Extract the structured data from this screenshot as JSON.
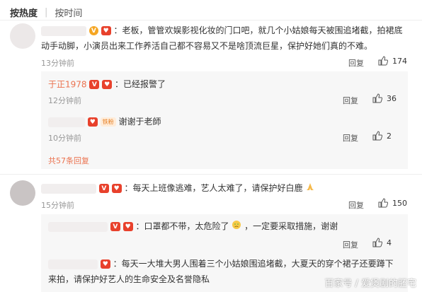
{
  "tabs": {
    "active": "按热度",
    "other": "按时间"
  },
  "comments": [
    {
      "text_line1": "：老板，管管欢娱影视化妆的门口吧，就几个小姑娘每天被围追堵截，拍裙底",
      "text_line2": "动手动脚，小演员出来工作养活自己都不容易又不是啥顶流巨星，保护好她们真的不难。",
      "time": "13分钟前",
      "reply": "回复",
      "likes": "174"
    },
    {
      "text": "：每天上班像逃难，艺人太难了，请保护好白鹿",
      "time": "15分钟前",
      "reply": "回复",
      "likes": "150"
    }
  ],
  "replies_1": [
    {
      "name": "于正1978",
      "text": "：已经报警了",
      "time": "12分钟前",
      "reply": "回复",
      "likes": "36"
    },
    {
      "text": "谢谢于老師",
      "time": "10分钟前",
      "reply": "回复",
      "likes": "2"
    }
  ],
  "more_replies": "共57条回复",
  "replies_2": [
    {
      "text_before": "：口罩都不带，太危险了",
      "text_after": "，一定要采取措施，谢谢",
      "reply": "回复",
      "likes": "4"
    },
    {
      "text_line1": "：每天一大堆大男人围着三个小姑娘围追堵截，大夏天的穿个裙子还要蹲下",
      "text_line2": "来拍，请保护好艺人的生命安全及名誉隐私"
    }
  ],
  "badges": {
    "v": "V",
    "fan_label": "铁粉"
  },
  "watermark": "百家号 / 爱煲剧的胚宅",
  "colors": {
    "accent": "#eb7350",
    "vip": "#f5a623",
    "badge_red": "#e8412c"
  },
  "icons": [
    "thumb-up-icon",
    "vip-badge-icon",
    "weibo-badge-icon",
    "fan-badge-icon",
    "cry-emoji-icon",
    "pray-emoji-icon"
  ]
}
